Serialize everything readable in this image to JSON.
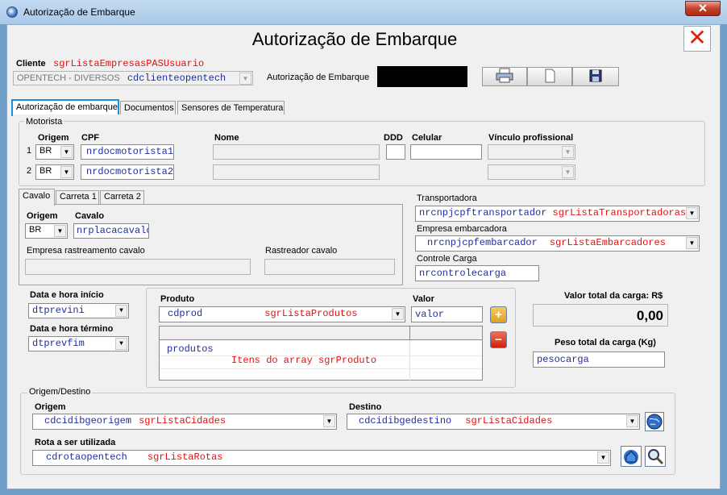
{
  "window": {
    "title": "Autorização de Embarque"
  },
  "header": {
    "title": "Autorização de Embarque"
  },
  "cliente": {
    "label": "Cliente",
    "list_ref": "sgrListaEmpresasPASUsuario",
    "selected": "OPENTECH - DIVERSOS",
    "code": "cdclienteopentech"
  },
  "autorizacao": {
    "label": "Autorização de Embarque",
    "value": ""
  },
  "tabs": [
    "Autorização de embarque",
    "Documentos",
    "Sensores de Temperatura"
  ],
  "motorista": {
    "group_label": "Motorista",
    "headers": {
      "origem": "Origem",
      "cpf": "CPF",
      "nome": "Nome",
      "ddd": "DDD",
      "celular": "Celular",
      "vinculo": "Vínculo profissional"
    },
    "rows": [
      {
        "index": "1",
        "origem": "BR",
        "cpf": "nrdocmotorista1",
        "nome": "",
        "ddd": "",
        "celular": ""
      },
      {
        "index": "2",
        "origem": "BR",
        "cpf": "nrdocmotorista2",
        "nome": ""
      }
    ]
  },
  "veiculo": {
    "tabs": [
      "Cavalo",
      "Carreta 1",
      "Carreta 2"
    ],
    "origem_label": "Origem",
    "origem_value": "BR",
    "cavalo_label": "Cavalo",
    "cavalo_value": "nrplacacavalo",
    "empresa_rastreamento_label": "Empresa rastreamento cavalo",
    "rastreador_label": "Rastreador cavalo"
  },
  "transportadora": {
    "label": "Transportadora",
    "code": "nrcnpjcpftransportador",
    "list_ref": "sgrListaTransportadoras"
  },
  "embarcadora": {
    "label": "Empresa embarcadora",
    "code": "nrcnpjcpfembarcador",
    "list_ref": "sgrListaEmbarcadores"
  },
  "controle_carga": {
    "label": "Controle Carga",
    "value": "nrcontrolecarga"
  },
  "datas": {
    "inicio_label": "Data e hora início",
    "inicio_value": "dtprevini",
    "termino_label": "Data e hora término",
    "termino_value": "dtprevfim"
  },
  "produto": {
    "label": "Produto",
    "code": "cdprod",
    "list_ref": "sgrListaProdutos",
    "valor_label": "Valor",
    "valor_value": "valor",
    "grid_text": "produtos",
    "grid_hint": "Itens do array sgrProduto",
    "add_icon": "plus-icon",
    "remove_icon": "minus-icon"
  },
  "totais": {
    "valor_label": "Valor total da carga: R$",
    "valor_value": "0,00",
    "peso_label": "Peso total da carga (Kg)",
    "peso_value": "pesocarga"
  },
  "origem_destino": {
    "group_label": "Origem/Destino",
    "origem_label": "Origem",
    "origem_code": "cdcidibgeorigem",
    "origem_list": "sgrListaCidades",
    "destino_label": "Destino",
    "destino_code": "cdcidibgedestino",
    "destino_list": "sgrListaCidades",
    "rota_label": "Rota a ser utilizada",
    "rota_code": "cdrotaopentech",
    "rota_list": "sgrListaRotas"
  },
  "colors": {
    "label_red": "#e01010",
    "code_blue": "#1f2ea0",
    "tab_focus": "#1c8fdc"
  }
}
